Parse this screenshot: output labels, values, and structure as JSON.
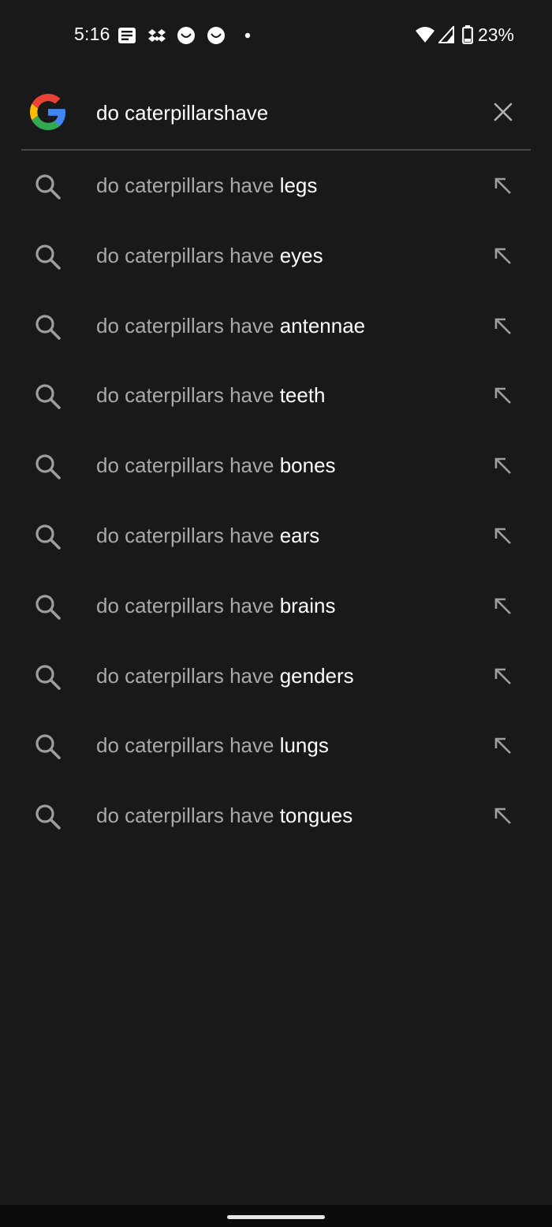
{
  "status_bar": {
    "time": "5:16",
    "left_icons": [
      "news-icon",
      "dropbox-icon",
      "face-icon",
      "face-icon",
      "dot-icon"
    ],
    "right_icons": [
      "wifi-icon",
      "signal-icon",
      "battery-icon"
    ],
    "battery_percent": "23%"
  },
  "search": {
    "query": "do caterpillarshave",
    "logo": "google-logo",
    "clear_icon": "close-icon"
  },
  "suggestions": [
    {
      "prefix": "do caterpillars have ",
      "completion": "legs"
    },
    {
      "prefix": "do caterpillars have ",
      "completion": "eyes"
    },
    {
      "prefix": "do caterpillars have ",
      "completion": "antennae"
    },
    {
      "prefix": "do caterpillars have ",
      "completion": "teeth"
    },
    {
      "prefix": "do caterpillars have ",
      "completion": "bones"
    },
    {
      "prefix": "do caterpillars have ",
      "completion": "ears"
    },
    {
      "prefix": "do caterpillars have ",
      "completion": "brains"
    },
    {
      "prefix": "do caterpillars have ",
      "completion": "genders"
    },
    {
      "prefix": "do caterpillars have ",
      "completion": "lungs"
    },
    {
      "prefix": "do caterpillars have ",
      "completion": "tongues"
    }
  ],
  "colors": {
    "background": "#191919",
    "prefix_text": "#a9a9a9",
    "completion_text": "#ffffff",
    "icon_gray": "#9e9e9e",
    "google_blue": "#4285F4",
    "google_red": "#EA4335",
    "google_yellow": "#FBBC05",
    "google_green": "#34A853"
  }
}
